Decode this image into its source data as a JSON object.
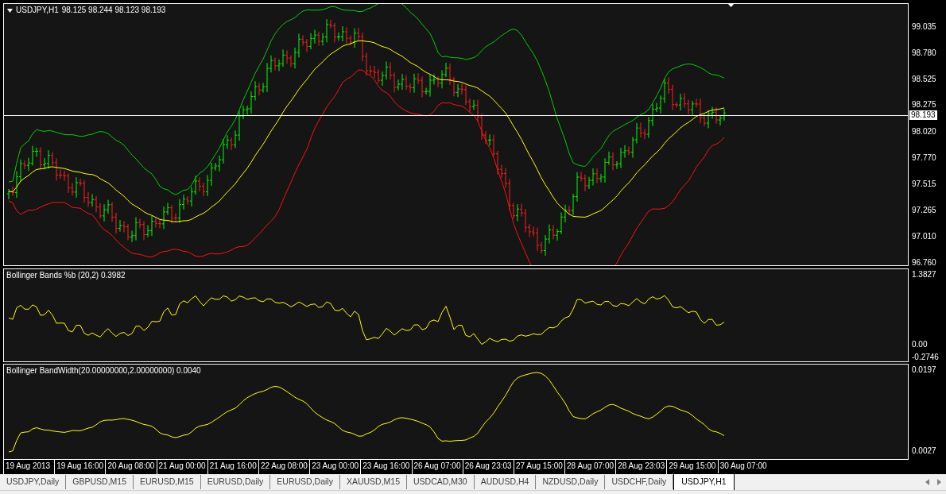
{
  "chart": {
    "header": {
      "symbol": "USDJPY,H1",
      "ohlc": "98.125 98.244 98.123 98.193"
    },
    "price_axis": [
      "99.035",
      "98.780",
      "98.525",
      "98.275",
      "98.020",
      "97.770",
      "97.515",
      "97.265",
      "97.010",
      "96.760"
    ],
    "current_price": "98.193"
  },
  "indicators": [
    {
      "label": "Bollinger Bands %b (20,2) 0.3982",
      "axis": [
        "1.3827",
        "0.00",
        "-0.2746"
      ]
    },
    {
      "label": "Bollinger BandWidth(20.00000000,2.00000000) 0.0040",
      "axis": [
        "0.0197",
        "0.0027"
      ]
    }
  ],
  "time_axis": [
    "19 Aug 2013",
    "19 Aug 16:00",
    "20 Aug 08:00",
    "21 Aug 00:00",
    "21 Aug 16:00",
    "22 Aug 08:00",
    "23 Aug 00:00",
    "23 Aug 16:00",
    "26 Aug 07:00",
    "26 Aug 23:03",
    "27 Aug 15:00",
    "28 Aug 07:00",
    "28 Aug 23:03",
    "29 Aug 15:00",
    "30 Aug 07:00"
  ],
  "tabs": [
    {
      "label": "USDJPY,Daily",
      "selected": false
    },
    {
      "label": "GBPUSD,M15",
      "selected": false
    },
    {
      "label": "EURUSD,M15",
      "selected": false
    },
    {
      "label": "EURUSD,Daily",
      "selected": false
    },
    {
      "label": "EURUSD,Daily",
      "selected": false
    },
    {
      "label": "XAUUSD,M15",
      "selected": false
    },
    {
      "label": "USDCAD,M30",
      "selected": false
    },
    {
      "label": "AUDUSD,H4",
      "selected": false
    },
    {
      "label": "NZDUSD,Daily",
      "selected": false
    },
    {
      "label": "USDCHF,Daily",
      "selected": false
    },
    {
      "label": "USDJPY,H1",
      "selected": true
    }
  ]
}
